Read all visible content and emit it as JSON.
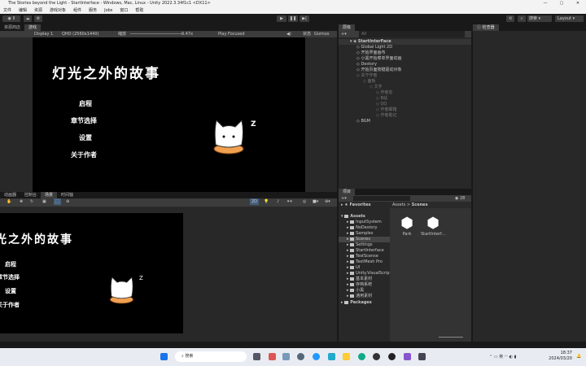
{
  "window": {
    "title": "The Stories beyond the Light - StartInterface - Windows, Mac, Linux - Unity 2022.3.34f1c1 <DX11>",
    "controls": [
      "—",
      "▢",
      "✕"
    ]
  },
  "menu": [
    "文件",
    "编辑",
    "资源",
    "游戏对象",
    "组件",
    "服务",
    "Jobs",
    "窗口",
    "帮助"
  ],
  "toolbar": {
    "account": "II",
    "search_label": "搜索",
    "layout": "Layout"
  },
  "game": {
    "tabs": [
      "资源商店",
      "游戏"
    ],
    "display": "Display 1",
    "resolution": "QHD (2560x1440)",
    "scale_label": "缩放",
    "scale_value": "0.47x",
    "play_mode": "Play Focused",
    "stats": "状态",
    "gizmos": "Gizmos",
    "title": "灯光之外的故事",
    "menu_items": [
      "启程",
      "章节选择",
      "设置",
      "关于作者"
    ],
    "zzz": "Z"
  },
  "scene": {
    "tabs": [
      "动画器",
      "控制台",
      "场景",
      "时间轴"
    ],
    "mode2d": "2D"
  },
  "hierarchy": {
    "tab": "层级",
    "search": "All",
    "root": "StartInterFace",
    "items": [
      {
        "label": "Global Light 2D",
        "depth": 1,
        "dim": false
      },
      {
        "label": "开始界面画布",
        "depth": 1,
        "dim": false
      },
      {
        "label": "小黑开始菜单界面动画",
        "depth": 1,
        "dim": false
      },
      {
        "label": "Destory",
        "depth": 1,
        "dim": false
      },
      {
        "label": "开始页面按键驱动对象",
        "depth": 1,
        "dim": false
      },
      {
        "label": "关于作者",
        "depth": 1,
        "dim": true
      },
      {
        "label": "面板",
        "depth": 2,
        "dim": true
      },
      {
        "label": "文字",
        "depth": 3,
        "dim": true
      },
      {
        "label": "作者名",
        "depth": 4,
        "dim": true
      },
      {
        "label": "B站",
        "depth": 4,
        "dim": true
      },
      {
        "label": "QQ",
        "depth": 4,
        "dim": true
      },
      {
        "label": "作者邮箱",
        "depth": 4,
        "dim": true
      },
      {
        "label": "作者助记",
        "depth": 4,
        "dim": true
      },
      {
        "label": "BGM",
        "depth": 1,
        "dim": false
      }
    ]
  },
  "inspector": {
    "tab": "检查器"
  },
  "project": {
    "tab": "项目",
    "count": "28",
    "favorites": "Favorites",
    "assets": "Assets",
    "packages": "Packages",
    "folders": [
      "InputSystem",
      "NoDestory",
      "Samples",
      "Scenes",
      "Settings",
      "StartInterface",
      "TestScense",
      "TextMesh Pro",
      "UI",
      "Unity.VisualScripting",
      "基本素材",
      "存档系统",
      "小黑",
      "通用素材"
    ],
    "selected": "Scenes",
    "breadcrumb": [
      "Assets",
      "Scenes"
    ],
    "files": [
      "Park",
      "StartInterf..."
    ]
  },
  "taskbar": {
    "search": "搜索",
    "time": "18:37",
    "date": "2024/03/20",
    "ime": "英"
  }
}
